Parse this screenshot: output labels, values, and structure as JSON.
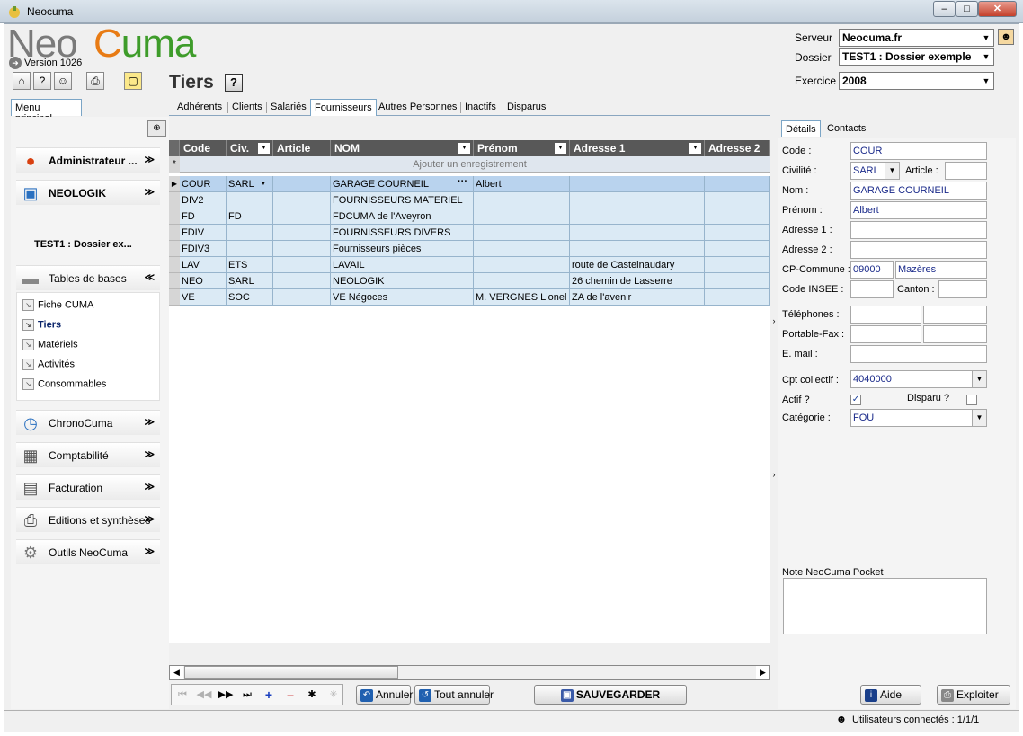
{
  "window": {
    "title": "Neocuma"
  },
  "header": {
    "logo_neo": "Neo",
    "logo_cuma": "Cuma",
    "version": "Version 1026",
    "page_title": "Tiers",
    "help_label": "?",
    "serveur_label": "Serveur",
    "serveur_value": "Neocuma.fr",
    "dossier_label": "Dossier",
    "dossier_value": "TEST1 : Dossier exemple",
    "exercice_label": "Exercice",
    "exercice_value": "2008"
  },
  "menu_tab": "Menu principal",
  "tabs": [
    "Adhérents",
    "Clients",
    "Salariés",
    "Fournisseurs",
    "Autres Personnes",
    "Inactifs",
    "Disparus"
  ],
  "sidebar": {
    "groups_top": [
      {
        "label": "Administrateur ...",
        "icon": "admin-icon"
      },
      {
        "label": "NEOLOGIK",
        "icon": "computer-icon"
      }
    ],
    "dossier": "TEST1 : Dossier ex...",
    "tables_group": "Tables de bases",
    "sub_items": [
      "Fiche CUMA",
      "Tiers",
      "Matériels",
      "Activités",
      "Consommables"
    ],
    "groups_bottom": [
      {
        "label": "ChronoCuma",
        "icon": "clock-icon"
      },
      {
        "label": "Comptabilité",
        "icon": "calculator-icon"
      },
      {
        "label": "Facturation",
        "icon": "invoice-icon"
      },
      {
        "label": "Editions et synthèses",
        "icon": "printer-icon"
      },
      {
        "label": "Outils NeoCuma",
        "icon": "gears-icon"
      }
    ]
  },
  "grid": {
    "columns": [
      "Code",
      "Civ.",
      "Article",
      "NOM",
      "Prénom",
      "Adresse 1",
      "Adresse 2"
    ],
    "add_row": "Ajouter un enregistrement",
    "rows": [
      [
        "COUR",
        "SARL",
        "",
        "GARAGE COURNEIL",
        "Albert",
        "",
        ""
      ],
      [
        "DIV2",
        "",
        "",
        "FOURNISSEURS MATERIEL",
        "",
        "",
        ""
      ],
      [
        "FD",
        "FD",
        "",
        "FDCUMA de l'Aveyron",
        "",
        "",
        ""
      ],
      [
        "FDIV",
        "",
        "",
        "FOURNISSEURS DIVERS",
        "",
        "",
        ""
      ],
      [
        "FDIV3",
        "",
        "",
        "Fournisseurs pièces",
        "",
        "",
        ""
      ],
      [
        "LAV",
        "ETS",
        "",
        "LAVAIL",
        "",
        "route de Castelnaudary",
        ""
      ],
      [
        "NEO",
        "SARL",
        "",
        "NEOLOGIK",
        "",
        "26 chemin de Lasserre",
        ""
      ],
      [
        "VE",
        "SOC",
        "",
        "VE Négoces",
        "M. VERGNES Lionel",
        "ZA de l'avenir",
        ""
      ]
    ]
  },
  "buttons": {
    "annuler": "Annuler",
    "tout_annuler": "Tout annuler",
    "sauvegarder": "SAUVEGARDER",
    "aide": "Aide",
    "exploiter": "Exploiter"
  },
  "detail": {
    "tabs": [
      "Détails",
      "Contacts"
    ],
    "code_label": "Code :",
    "code": "COUR",
    "civilite_label": "Civilité :",
    "civilite": "SARL",
    "article_label": "Article :",
    "article": "",
    "nom_label": "Nom :",
    "nom": "GARAGE COURNEIL",
    "prenom_label": "Prénom :",
    "prenom": "Albert",
    "adresse1_label": "Adresse 1 :",
    "adresse1": "",
    "adresse2_label": "Adresse 2 :",
    "adresse2": "",
    "cp_label": "CP-Commune :",
    "cp": "09000",
    "commune": "Mazères",
    "insee_label": "Code INSEE :",
    "insee": "",
    "canton_label": "Canton :",
    "canton": "",
    "telephones_label": "Téléphones :",
    "portable_label": "Portable-Fax :",
    "email_label": "E. mail :",
    "cpt_label": "Cpt collectif :",
    "cpt": "4040000",
    "actif_label": "Actif ?",
    "actif": true,
    "disparu_label": "Disparu ?",
    "disparu": false,
    "categorie_label": "Catégorie :",
    "categorie": "FOU",
    "note_label": "Note NeoCuma Pocket"
  },
  "status": {
    "users": "Utilisateurs connectés : 1/1/1"
  }
}
